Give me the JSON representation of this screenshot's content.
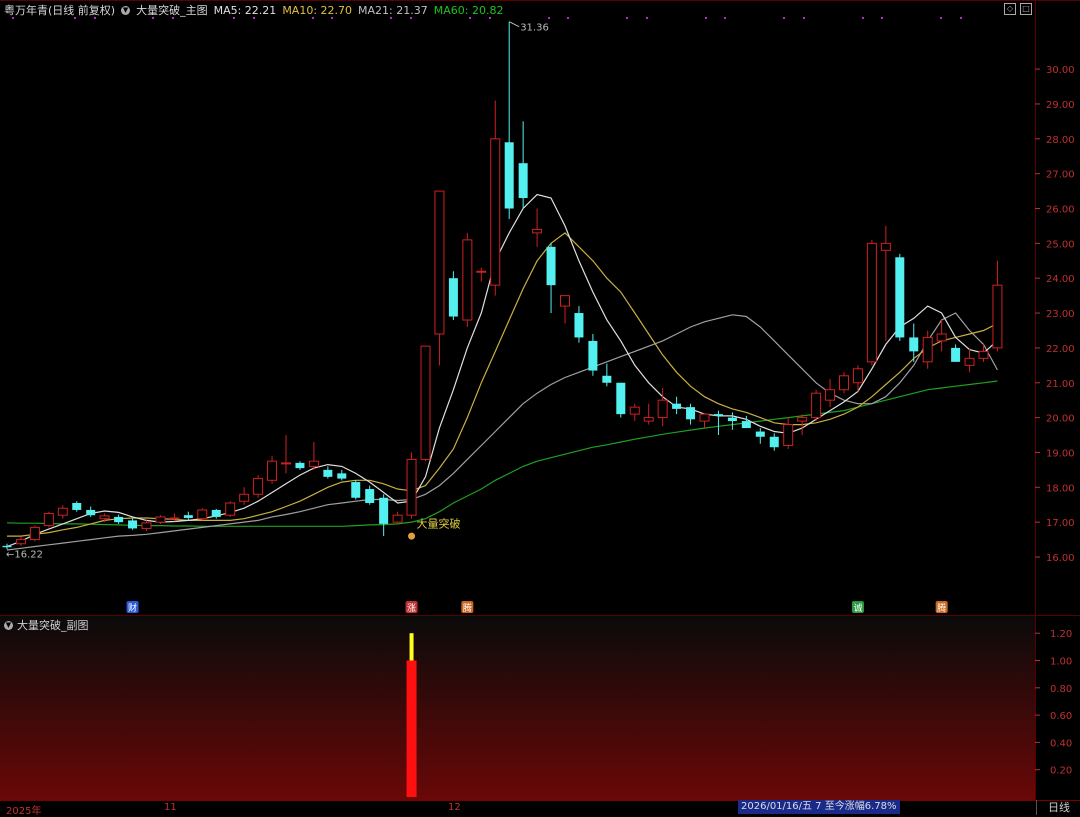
{
  "header": {
    "stock": "粤万年青(日线 前复权)",
    "indicator": "大量突破_主图",
    "ma5_label": "MA5: 22.21",
    "ma10_label": "MA10: 22.70",
    "ma21_label": "MA21: 21.37",
    "ma60_label": "MA60: 20.82"
  },
  "sub_header": {
    "indicator": "大量突破_副图"
  },
  "annotations": {
    "high": "31.36",
    "low": "16.22",
    "signal": "大量突破"
  },
  "event_tags": [
    {
      "label": "财",
      "bar": 9,
      "color": "#2a5ad8"
    },
    {
      "label": "涨",
      "bar": 29,
      "color": "#c03030"
    },
    {
      "label": "腾",
      "bar": 33,
      "color": "#c86820"
    },
    {
      "label": "诚",
      "bar": 61,
      "color": "#2a9a40"
    },
    {
      "label": "腾",
      "bar": 67,
      "color": "#c86820"
    }
  ],
  "bottom_axis": {
    "year": "2025年",
    "m11": "11",
    "m12": "12"
  },
  "status_text": "2026/01/16/五 7 至今涨幅6.78%",
  "period_button": "日线",
  "colors": {
    "up": "#d02020",
    "down": "#54f0f0",
    "ma5": "#e0e0e0",
    "ma10": "#c8b040",
    "ma21": "#a0a0a0",
    "ma60": "#20a020",
    "axis": "#c03030",
    "grid": "#5a0000"
  },
  "chart_data": [
    {
      "type": "candlestick",
      "title": "大量突破_主图",
      "ylim": [
        15.1,
        31.8
      ],
      "yticks": [
        16.0,
        17.0,
        18.0,
        19.0,
        20.0,
        21.0,
        22.0,
        23.0,
        24.0,
        25.0,
        26.0,
        27.0,
        28.0,
        29.0,
        30.0
      ],
      "ohlc": [
        [
          16.32,
          16.38,
          16.22,
          16.28
        ],
        [
          16.38,
          16.58,
          16.32,
          16.5
        ],
        [
          16.5,
          16.9,
          16.45,
          16.85
        ],
        [
          16.9,
          17.3,
          16.85,
          17.25
        ],
        [
          17.2,
          17.48,
          17.1,
          17.4
        ],
        [
          17.55,
          17.6,
          17.3,
          17.35
        ],
        [
          17.35,
          17.45,
          17.15,
          17.2
        ],
        [
          17.1,
          17.25,
          17.0,
          17.18
        ],
        [
          17.15,
          17.22,
          16.95,
          17.0
        ],
        [
          17.05,
          17.1,
          16.78,
          16.82
        ],
        [
          16.82,
          17.05,
          16.75,
          16.98
        ],
        [
          17.0,
          17.2,
          16.95,
          17.15
        ],
        [
          17.1,
          17.25,
          17.02,
          17.12
        ],
        [
          17.2,
          17.3,
          17.05,
          17.12
        ],
        [
          17.1,
          17.4,
          17.05,
          17.35
        ],
        [
          17.35,
          17.38,
          17.1,
          17.15
        ],
        [
          17.2,
          17.6,
          17.15,
          17.55
        ],
        [
          17.6,
          18.0,
          17.5,
          17.8
        ],
        [
          17.8,
          18.35,
          17.7,
          18.25
        ],
        [
          18.2,
          18.9,
          18.1,
          18.75
        ],
        [
          18.7,
          19.5,
          18.4,
          18.7
        ],
        [
          18.7,
          18.75,
          18.5,
          18.55
        ],
        [
          18.6,
          19.3,
          18.5,
          18.75
        ],
        [
          18.5,
          18.6,
          18.25,
          18.3
        ],
        [
          18.4,
          18.5,
          18.2,
          18.25
        ],
        [
          18.15,
          18.2,
          17.65,
          17.7
        ],
        [
          17.95,
          18.05,
          17.5,
          17.55
        ],
        [
          17.7,
          17.8,
          16.6,
          16.95
        ],
        [
          17.0,
          17.3,
          16.95,
          17.2
        ],
        [
          17.2,
          19.0,
          17.1,
          18.8
        ],
        [
          18.8,
          22.05,
          18.75,
          22.05
        ],
        [
          22.4,
          26.5,
          21.5,
          26.5
        ],
        [
          24.0,
          24.2,
          22.8,
          22.9
        ],
        [
          22.8,
          25.3,
          22.6,
          25.1
        ],
        [
          24.2,
          24.3,
          23.9,
          24.2
        ],
        [
          23.8,
          29.1,
          23.5,
          28.0
        ],
        [
          27.9,
          31.36,
          25.7,
          26.0
        ],
        [
          27.3,
          28.5,
          26.0,
          26.3
        ],
        [
          25.3,
          26.0,
          24.9,
          25.4
        ],
        [
          24.9,
          25.0,
          23.0,
          23.8
        ],
        [
          23.2,
          23.5,
          22.7,
          23.5
        ],
        [
          23.0,
          23.2,
          22.15,
          22.3
        ],
        [
          22.2,
          22.4,
          21.2,
          21.35
        ],
        [
          21.2,
          21.55,
          20.9,
          21.0
        ],
        [
          21.0,
          21.0,
          20.0,
          20.1
        ],
        [
          20.1,
          20.4,
          19.9,
          20.3
        ],
        [
          19.9,
          20.4,
          19.8,
          20.0
        ],
        [
          20.0,
          20.85,
          19.75,
          20.5
        ],
        [
          20.4,
          20.6,
          20.1,
          20.25
        ],
        [
          20.3,
          20.4,
          19.8,
          19.95
        ],
        [
          19.9,
          20.1,
          19.7,
          20.1
        ],
        [
          20.1,
          20.2,
          19.5,
          20.05
        ],
        [
          20.0,
          20.15,
          19.65,
          19.9
        ],
        [
          19.9,
          20.05,
          19.7,
          19.7
        ],
        [
          19.6,
          19.7,
          19.25,
          19.45
        ],
        [
          19.45,
          19.55,
          19.05,
          19.15
        ],
        [
          19.2,
          20.0,
          19.1,
          19.8
        ],
        [
          19.9,
          20.1,
          19.5,
          20.0
        ],
        [
          20.0,
          20.8,
          19.9,
          20.7
        ],
        [
          20.5,
          21.1,
          20.3,
          20.8
        ],
        [
          20.8,
          21.3,
          20.7,
          21.2
        ],
        [
          21.0,
          21.5,
          20.75,
          21.4
        ],
        [
          21.6,
          25.1,
          21.5,
          25.0
        ],
        [
          24.8,
          25.5,
          22.2,
          25.0
        ],
        [
          24.6,
          24.7,
          22.2,
          22.3
        ],
        [
          22.3,
          22.7,
          21.6,
          21.9
        ],
        [
          21.6,
          22.5,
          21.4,
          22.3
        ],
        [
          22.2,
          22.8,
          21.9,
          22.4
        ],
        [
          22.0,
          22.1,
          21.6,
          21.6
        ],
        [
          21.5,
          22.0,
          21.3,
          21.7
        ],
        [
          21.7,
          22.1,
          21.6,
          21.9
        ],
        [
          22.0,
          24.5,
          21.9,
          23.8
        ]
      ],
      "ma5": [
        16.3,
        16.45,
        16.65,
        16.8,
        16.95,
        17.1,
        17.25,
        17.32,
        17.28,
        17.15,
        17.05,
        17.0,
        17.02,
        17.05,
        17.1,
        17.18,
        17.28,
        17.4,
        17.6,
        17.85,
        18.1,
        18.35,
        18.55,
        18.65,
        18.6,
        18.4,
        18.15,
        17.85,
        17.55,
        17.6,
        18.3,
        19.7,
        20.8,
        22.0,
        23.0,
        24.5,
        25.3,
        26.0,
        26.4,
        26.3,
        25.5,
        24.5,
        23.6,
        22.8,
        22.2,
        21.5,
        21.0,
        20.6,
        20.3,
        20.25,
        20.1,
        20.05,
        20.05,
        19.95,
        19.75,
        19.6,
        19.55,
        19.7,
        19.95,
        20.2,
        20.45,
        20.75,
        21.4,
        22.1,
        22.6,
        22.85,
        23.2,
        23.0,
        22.3,
        21.95,
        21.85,
        22.21
      ],
      "ma10": [
        16.6,
        16.6,
        16.65,
        16.7,
        16.78,
        16.85,
        16.95,
        17.05,
        17.1,
        17.12,
        17.12,
        17.1,
        17.08,
        17.05,
        17.05,
        17.05,
        17.05,
        17.1,
        17.2,
        17.3,
        17.45,
        17.6,
        17.8,
        18.0,
        18.15,
        18.2,
        18.2,
        18.1,
        17.95,
        17.9,
        18.05,
        18.55,
        19.1,
        20.0,
        21.0,
        21.9,
        22.8,
        23.7,
        24.5,
        25.0,
        25.3,
        24.9,
        24.5,
        24.0,
        23.6,
        23.0,
        22.4,
        21.8,
        21.3,
        20.9,
        20.6,
        20.4,
        20.25,
        20.15,
        20.0,
        19.85,
        19.8,
        19.8,
        19.85,
        19.95,
        20.1,
        20.3,
        20.6,
        20.95,
        21.3,
        21.7,
        22.0,
        22.2,
        22.3,
        22.4,
        22.5,
        22.7
      ],
      "ma21": [
        16.2,
        16.25,
        16.3,
        16.35,
        16.4,
        16.45,
        16.5,
        16.55,
        16.6,
        16.62,
        16.65,
        16.7,
        16.75,
        16.8,
        16.85,
        16.9,
        16.95,
        17.0,
        17.05,
        17.15,
        17.22,
        17.3,
        17.4,
        17.5,
        17.55,
        17.6,
        17.65,
        17.65,
        17.62,
        17.65,
        17.8,
        18.05,
        18.4,
        18.8,
        19.2,
        19.6,
        20.0,
        20.4,
        20.7,
        20.95,
        21.15,
        21.3,
        21.45,
        21.6,
        21.75,
        21.9,
        22.05,
        22.2,
        22.4,
        22.6,
        22.75,
        22.85,
        22.95,
        22.9,
        22.6,
        22.2,
        21.8,
        21.4,
        21.0,
        20.7,
        20.5,
        20.4,
        20.4,
        20.6,
        21.0,
        21.5,
        22.2,
        22.8,
        23.0,
        22.5,
        22.1,
        21.37
      ],
      "ma60": [
        16.98,
        16.97,
        16.97,
        16.96,
        16.95,
        16.95,
        16.94,
        16.93,
        16.92,
        16.91,
        16.9,
        16.9,
        16.89,
        16.89,
        16.88,
        16.88,
        16.88,
        16.88,
        16.88,
        16.88,
        16.88,
        16.88,
        16.88,
        16.88,
        16.88,
        16.9,
        16.92,
        16.93,
        16.95,
        17.0,
        17.1,
        17.3,
        17.55,
        17.75,
        17.95,
        18.2,
        18.4,
        18.6,
        18.75,
        18.85,
        18.95,
        19.05,
        19.15,
        19.22,
        19.3,
        19.38,
        19.45,
        19.52,
        19.58,
        19.64,
        19.7,
        19.75,
        19.8,
        19.85,
        19.9,
        19.95,
        20.0,
        20.05,
        20.1,
        20.15,
        20.2,
        20.3,
        20.4,
        20.5,
        20.6,
        20.7,
        20.8,
        20.85,
        20.9,
        20.95,
        21.0,
        21.05
      ]
    },
    {
      "type": "bar",
      "title": "大量突破_副图",
      "ylim": [
        0,
        1.28
      ],
      "yticks": [
        0.2,
        0.4,
        0.6,
        0.8,
        1.0,
        1.2
      ],
      "signal_bar": 29,
      "signal_value": 1.0,
      "cap_value": 1.2
    }
  ]
}
